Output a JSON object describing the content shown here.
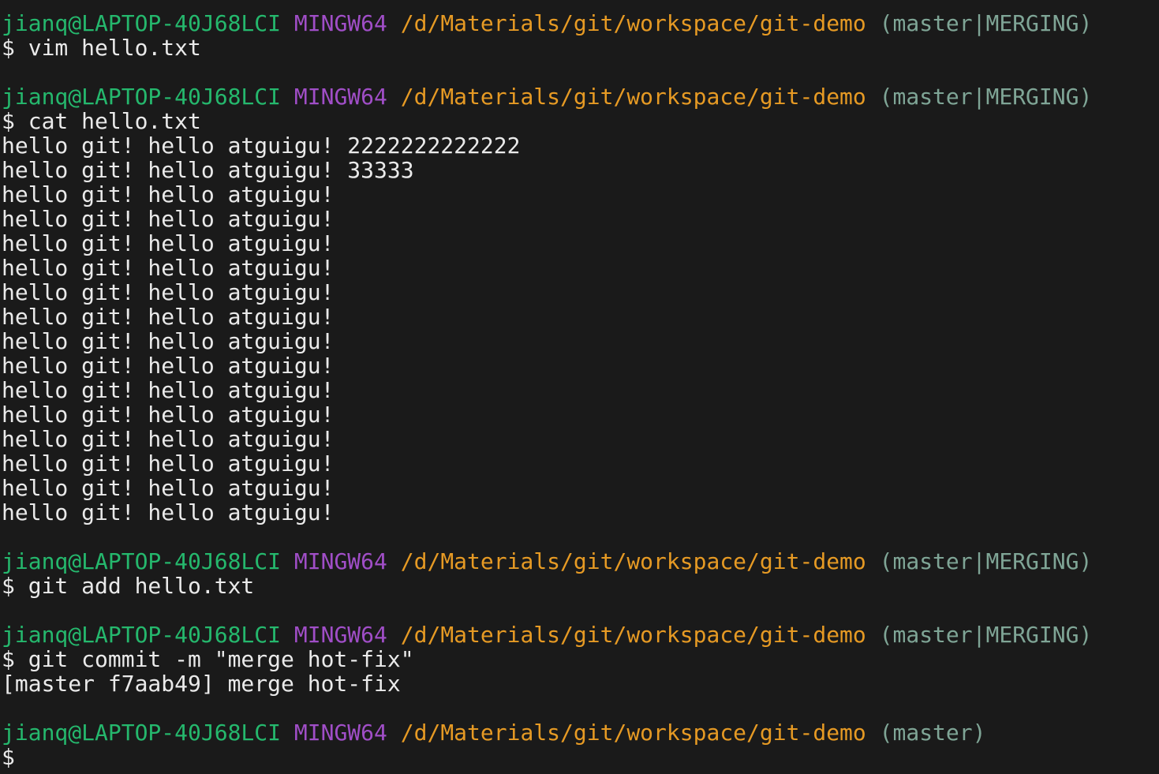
{
  "colors": {
    "background": "#1a1a1a",
    "user_host": "#25b86d",
    "system": "#a04ec7",
    "path": "#e69a24",
    "branch": "#7fa596",
    "text": "#eaeaea"
  },
  "terminal": {
    "lines": [
      {
        "type": "prompt",
        "user": "jianq@LAPTOP-40J68LCI",
        "system": "MINGW64",
        "path": "/d/Materials/git/workspace/git-demo",
        "branch": "(master|MERGING)"
      },
      {
        "type": "command",
        "text": "$ vim hello.txt"
      },
      {
        "type": "blank"
      },
      {
        "type": "prompt",
        "user": "jianq@LAPTOP-40J68LCI",
        "system": "MINGW64",
        "path": "/d/Materials/git/workspace/git-demo",
        "branch": "(master|MERGING)"
      },
      {
        "type": "command",
        "text": "$ cat hello.txt"
      },
      {
        "type": "output",
        "text": "hello git! hello atguigu! 2222222222222"
      },
      {
        "type": "output",
        "text": "hello git! hello atguigu! 33333"
      },
      {
        "type": "output",
        "text": "hello git! hello atguigu!"
      },
      {
        "type": "output",
        "text": "hello git! hello atguigu!"
      },
      {
        "type": "output",
        "text": "hello git! hello atguigu!"
      },
      {
        "type": "output",
        "text": "hello git! hello atguigu!"
      },
      {
        "type": "output",
        "text": "hello git! hello atguigu!"
      },
      {
        "type": "output",
        "text": "hello git! hello atguigu!"
      },
      {
        "type": "output",
        "text": "hello git! hello atguigu!"
      },
      {
        "type": "output",
        "text": "hello git! hello atguigu!"
      },
      {
        "type": "output",
        "text": "hello git! hello atguigu!"
      },
      {
        "type": "output",
        "text": "hello git! hello atguigu!"
      },
      {
        "type": "output",
        "text": "hello git! hello atguigu!"
      },
      {
        "type": "output",
        "text": "hello git! hello atguigu!"
      },
      {
        "type": "output",
        "text": "hello git! hello atguigu!"
      },
      {
        "type": "output",
        "text": "hello git! hello atguigu!"
      },
      {
        "type": "blank"
      },
      {
        "type": "prompt",
        "user": "jianq@LAPTOP-40J68LCI",
        "system": "MINGW64",
        "path": "/d/Materials/git/workspace/git-demo",
        "branch": "(master|MERGING)"
      },
      {
        "type": "command",
        "text": "$ git add hello.txt"
      },
      {
        "type": "blank"
      },
      {
        "type": "prompt",
        "user": "jianq@LAPTOP-40J68LCI",
        "system": "MINGW64",
        "path": "/d/Materials/git/workspace/git-demo",
        "branch": "(master|MERGING)"
      },
      {
        "type": "command",
        "text": "$ git commit -m \"merge hot-fix\""
      },
      {
        "type": "output",
        "text": "[master f7aab49] merge hot-fix"
      },
      {
        "type": "blank"
      },
      {
        "type": "prompt",
        "user": "jianq@LAPTOP-40J68LCI",
        "system": "MINGW64",
        "path": "/d/Materials/git/workspace/git-demo",
        "branch": "(master)"
      },
      {
        "type": "command",
        "text": "$"
      }
    ]
  }
}
